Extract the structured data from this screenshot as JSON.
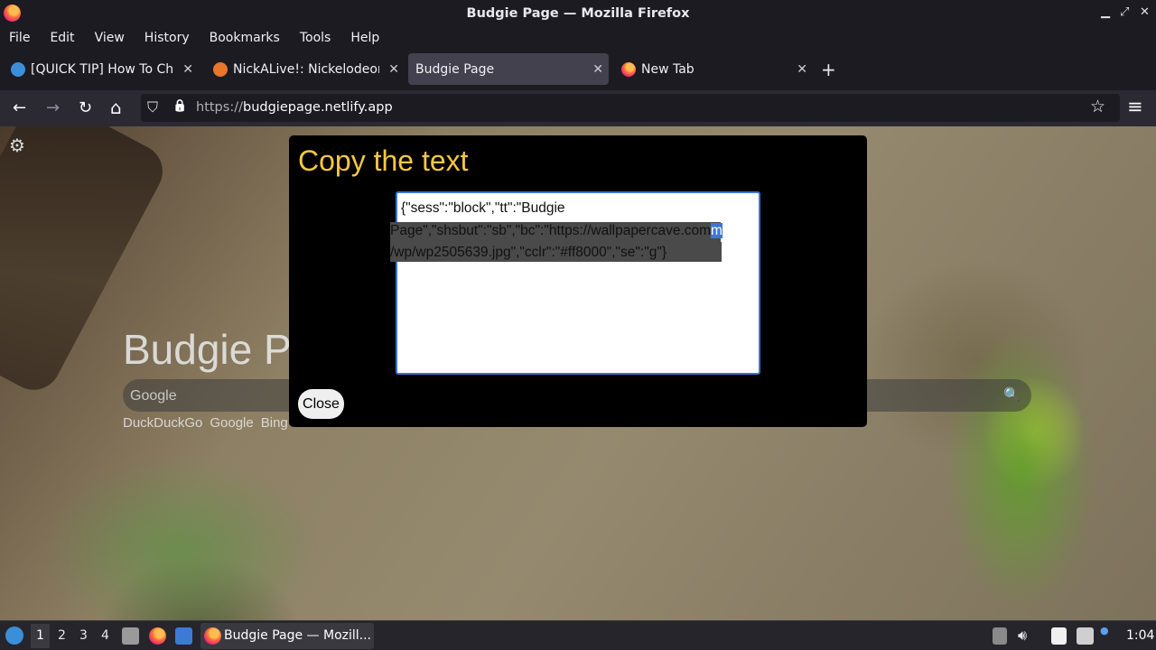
{
  "window": {
    "title": "Budgie Page — Mozilla Firefox",
    "minimize_glyph": "▁",
    "maximize_glyph": "⤢",
    "close_glyph": "✕"
  },
  "menubar": {
    "items": [
      "File",
      "Edit",
      "View",
      "History",
      "Bookmarks",
      "Tools",
      "Help"
    ]
  },
  "tabs": [
    {
      "label": "[QUICK TIP] How To Chan",
      "icon": "gauge-icon",
      "icon_color": "#3b8fd9",
      "active": false
    },
    {
      "label": "NickALive!: Nickelodeon",
      "icon": "nickalive-icon",
      "icon_color": "#e8762b",
      "active": false
    },
    {
      "label": "Budgie Page",
      "icon": "",
      "icon_color": "",
      "active": true
    },
    {
      "label": "New Tab",
      "icon": "firefox-icon",
      "icon_color": "#ff7139",
      "active": false
    }
  ],
  "tab_close_glyph": "✕",
  "new_tab_glyph": "+",
  "navbar": {
    "back_glyph": "←",
    "forward_glyph": "→",
    "reload_glyph": "↻",
    "home_glyph": "⌂",
    "shield_glyph": "⛉",
    "lock_glyph": "🔒",
    "url_scheme": "https://",
    "url_host": "budgiepage.netlify.app",
    "bookmark_glyph": "☆",
    "menu_glyph": "≡"
  },
  "page": {
    "settings_glyph": "⚙",
    "heading": "Budgie P",
    "search_placeholder": "Google",
    "search_glyph": "🔍",
    "engines": [
      "DuckDuckGo",
      "Google",
      "Bing"
    ]
  },
  "modal": {
    "title": "Copy the text",
    "textarea_line1": "{\"sess\":\"block\",\"tt\":\"Budgie",
    "textarea_line2": "Page\",\"shsbut\":\"sb\",\"bc\":\"https://wallpapercave.com",
    "textarea_line2_highlight": "m",
    "textarea_line3": "/wp/wp2505639.jpg\",\"cclr\":\"#ff8000\",\"se\":\"g\"}",
    "close_label": "Close"
  },
  "taskbar": {
    "workspaces": [
      "1",
      "2",
      "3",
      "4"
    ],
    "task_label": "Budgie Page — Mozill...",
    "clock": "1:04"
  },
  "colors": {
    "accent": "#3b76d6",
    "modal_title": "#f6c744"
  }
}
